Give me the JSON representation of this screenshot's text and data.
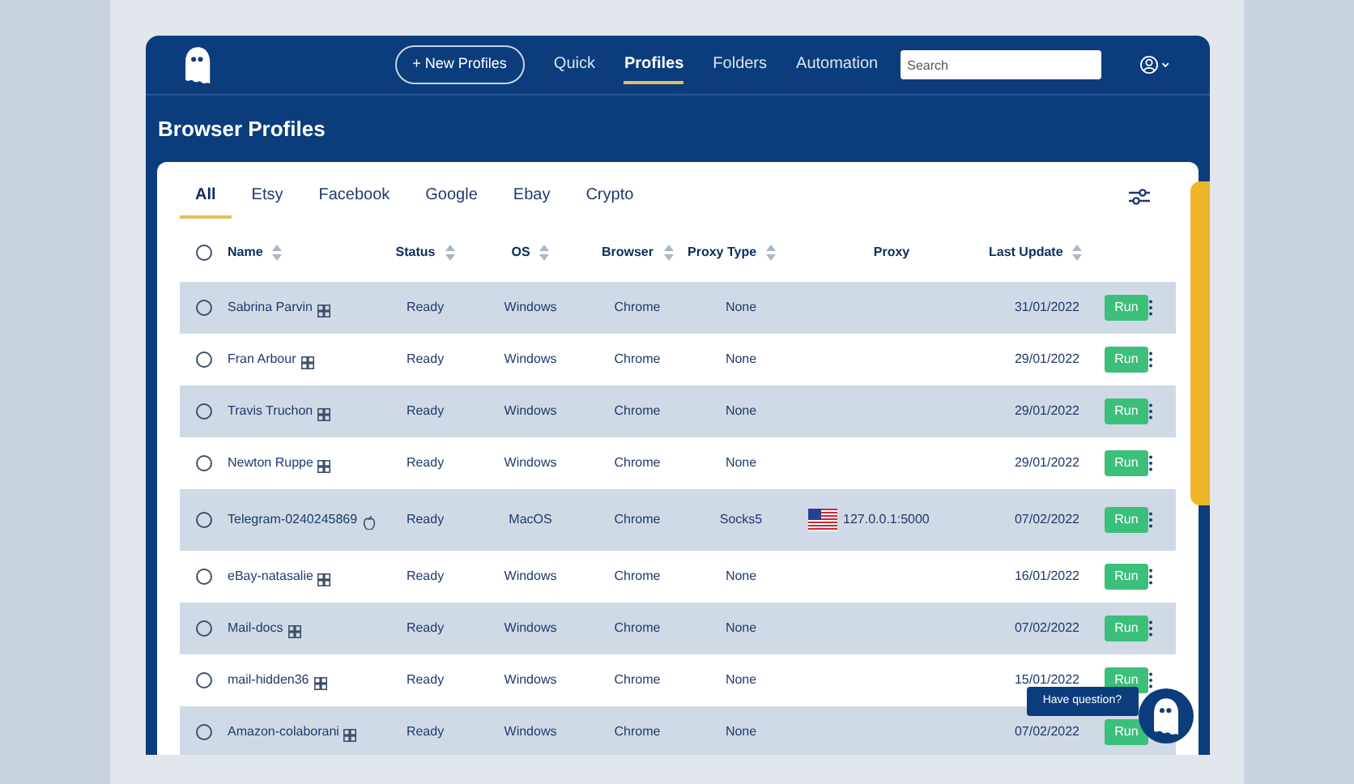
{
  "header": {
    "new_button": "+ New Profiles",
    "nav": [
      {
        "label": "Quick",
        "selected": false
      },
      {
        "label": "Profiles",
        "selected": true
      },
      {
        "label": "Folders",
        "selected": false
      },
      {
        "label": "Automation",
        "selected": false
      }
    ],
    "search": {
      "placeholder": "Search"
    }
  },
  "title": "Browser Profiles",
  "filters": [
    {
      "label": "All",
      "selected": true
    },
    {
      "label": "Etsy",
      "selected": false
    },
    {
      "label": "Facebook",
      "selected": false
    },
    {
      "label": "Google",
      "selected": false
    },
    {
      "label": "Ebay",
      "selected": false
    },
    {
      "label": "Crypto",
      "selected": false
    }
  ],
  "table": {
    "select_all_checked": false,
    "columns": [
      {
        "label": "Name",
        "sortable": true
      },
      {
        "label": "Status",
        "sortable": true
      },
      {
        "label": "OS",
        "sortable": true
      },
      {
        "label": "Browser",
        "sortable": true
      },
      {
        "label": "Proxy Type",
        "sortable": true
      },
      {
        "label": "Proxy",
        "sortable": false
      },
      {
        "label": "Last Update",
        "sortable": true
      }
    ],
    "rows": [
      {
        "checked": false,
        "kind": "windows",
        "name": "Sabrina Parvin",
        "status": "Ready",
        "os": "Windows",
        "browser": "Chrome",
        "proxy_type": "None",
        "updated": "31/01/2022",
        "action": "Run"
      },
      {
        "checked": false,
        "kind": "windows",
        "name": "Fran Arbour",
        "status": "Ready",
        "os": "Windows",
        "browser": "Chrome",
        "proxy_type": "None",
        "updated": "29/01/2022",
        "action": "Run"
      },
      {
        "checked": false,
        "kind": "windows",
        "name": "Travis Truchon",
        "status": "Ready",
        "os": "Windows",
        "browser": "Chrome",
        "proxy_type": "None",
        "updated": "29/01/2022",
        "action": "Run"
      },
      {
        "checked": false,
        "kind": "windows",
        "name": "Newton Ruppe",
        "status": "Ready",
        "os": "Windows",
        "browser": "Chrome",
        "proxy_type": "None",
        "updated": "29/01/2022",
        "action": "Run"
      },
      {
        "checked": false,
        "kind": "apple",
        "name": "Telegram-0240245869",
        "status": "Ready",
        "os": "MacOS",
        "browser": "Chrome",
        "proxy_type": "Socks5",
        "proxy": {
          "kind": "flagged",
          "address": "127.0.0.1:5000"
        },
        "updated": "07/02/2022",
        "action": "Run"
      },
      {
        "checked": false,
        "kind": "windows",
        "name": "eBay-natasalie",
        "status": "Ready",
        "os": "Windows",
        "browser": "Chrome",
        "proxy_type": "None",
        "updated": "16/01/2022",
        "action": "Run"
      },
      {
        "checked": false,
        "kind": "windows",
        "name": "Mail-docs",
        "status": "Ready",
        "os": "Windows",
        "browser": "Chrome",
        "proxy_type": "None",
        "updated": "07/02/2022",
        "action": "Run"
      },
      {
        "checked": false,
        "kind": "windows",
        "name": "mail-hidden36",
        "status": "Ready",
        "os": "Windows",
        "browser": "Chrome",
        "proxy_type": "None",
        "updated": "15/01/2022",
        "action": "Run"
      },
      {
        "checked": false,
        "kind": "windows",
        "name": "Amazon-colaborani",
        "status": "Ready",
        "os": "Windows",
        "browser": "Chrome",
        "proxy_type": "None",
        "updated": "07/02/2022",
        "action": "Run"
      }
    ]
  },
  "help": {
    "label": "Have question?"
  }
}
